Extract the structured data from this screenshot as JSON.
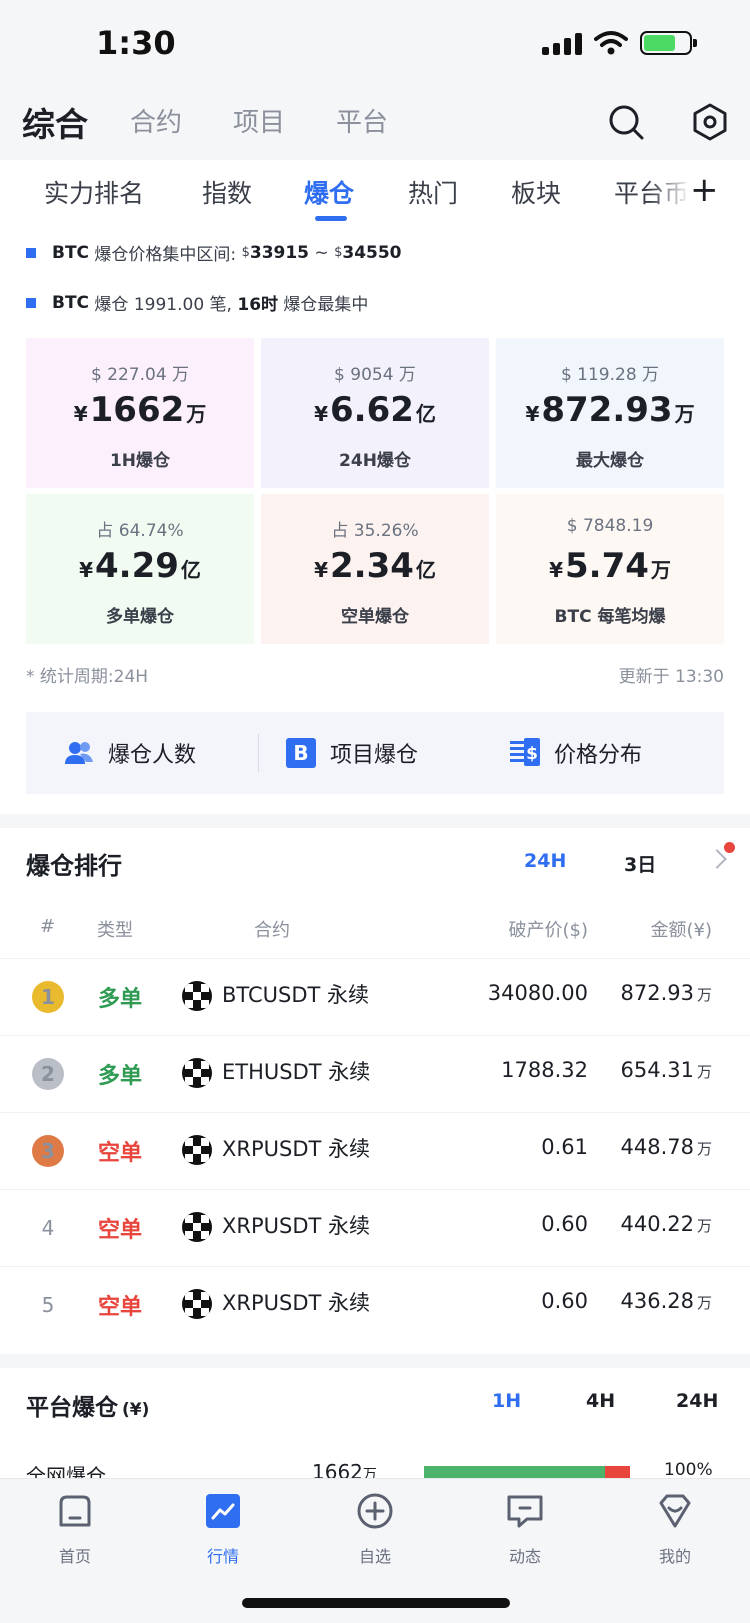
{
  "status": {
    "time": "1:30"
  },
  "top_nav": {
    "tabs": [
      "综合",
      "合约",
      "项目",
      "平台"
    ]
  },
  "sub_tabs": [
    "实力排名",
    "指数",
    "爆仓",
    "热门",
    "板块",
    "平台币"
  ],
  "info": {
    "line1": {
      "prefix": "BTC",
      "text": " 爆仓价格集中区间: ",
      "cur1": "$",
      "low": "33915",
      "sep": " ~ ",
      "cur2": "$",
      "high": "34550"
    },
    "line2": {
      "prefix": "BTC",
      "text1": " 爆仓 1991.00 笔, ",
      "bold": "16时",
      "text2": " 爆仓最集中"
    }
  },
  "cards": [
    {
      "sub": "$ 227.04 万",
      "sym": "¥",
      "value": "1662",
      "unit": "万",
      "label": "1H爆仓",
      "bg": "#fbf0fb"
    },
    {
      "sub": "$ 9054 万",
      "sym": "¥",
      "value": "6.62",
      "unit": "亿",
      "label": "24H爆仓",
      "bg": "#f3f1fb"
    },
    {
      "sub": "$ 119.28 万",
      "sym": "¥",
      "value": "872.93",
      "unit": "万",
      "label": "最大爆仓",
      "bg": "#f1f5fc"
    },
    {
      "sub": "占 64.74%",
      "sym": "¥",
      "value": "4.29",
      "unit": "亿",
      "label": "多单爆仓",
      "bg": "#f1fbf1"
    },
    {
      "sub": "占 35.26%",
      "sym": "¥",
      "value": "2.34",
      "unit": "亿",
      "label": "空单爆仓",
      "bg": "#fcf3f1"
    },
    {
      "sub": "$ 7848.19",
      "sym": "¥",
      "value": "5.74",
      "unit": "万",
      "label": "BTC 每笔均爆",
      "bg": "#fdf8f3"
    }
  ],
  "foot": {
    "period": "* 统计周期:24H",
    "updated": "更新于 13:30"
  },
  "quick": [
    {
      "label": "爆仓人数",
      "icon": "users-icon"
    },
    {
      "label": "项目爆仓",
      "icon": "bitcoin-icon"
    },
    {
      "label": "价格分布",
      "icon": "price-list-icon"
    }
  ],
  "ranking": {
    "title": "爆仓排行",
    "periods": [
      "24H",
      "3日"
    ],
    "headers": [
      "#",
      "类型",
      "合约",
      "破产价($)",
      "金额(¥)"
    ],
    "rows": [
      {
        "rank": "1",
        "type": "多单",
        "side": "long",
        "contract": "BTCUSDT 永续",
        "price": "34080.00",
        "amount": "872.93",
        "unit": "万"
      },
      {
        "rank": "2",
        "type": "多单",
        "side": "long",
        "contract": "ETHUSDT 永续",
        "price": "1788.32",
        "amount": "654.31",
        "unit": "万"
      },
      {
        "rank": "3",
        "type": "空单",
        "side": "short",
        "contract": "XRPUSDT 永续",
        "price": "0.61",
        "amount": "448.78",
        "unit": "万"
      },
      {
        "rank": "4",
        "type": "空单",
        "side": "short",
        "contract": "XRPUSDT 永续",
        "price": "0.60",
        "amount": "440.22",
        "unit": "万"
      },
      {
        "rank": "5",
        "type": "空单",
        "side": "short",
        "contract": "XRPUSDT 永续",
        "price": "0.60",
        "amount": "436.28",
        "unit": "万"
      }
    ]
  },
  "platform": {
    "title": "平台爆仓",
    "title_unit": "(¥)",
    "tabs": [
      "1H",
      "4H",
      "24H"
    ],
    "row": {
      "name": "全网爆仓",
      "value": "1662",
      "unit": "万",
      "percent": "100%",
      "long_share": 0.88
    }
  },
  "tabbar": [
    {
      "label": "首页",
      "icon": "home-icon"
    },
    {
      "label": "行情",
      "icon": "market-chart-icon"
    },
    {
      "label": "自选",
      "icon": "add-circle-icon"
    },
    {
      "label": "动态",
      "icon": "message-icon"
    },
    {
      "label": "我的",
      "icon": "profile-icon"
    }
  ],
  "colors": {
    "accent": "#2f6ef0",
    "long": "#2e9a52",
    "short": "#e8453c",
    "gold": "#e9b92e",
    "silver": "#b9bec7",
    "bronze": "#de7a45"
  }
}
